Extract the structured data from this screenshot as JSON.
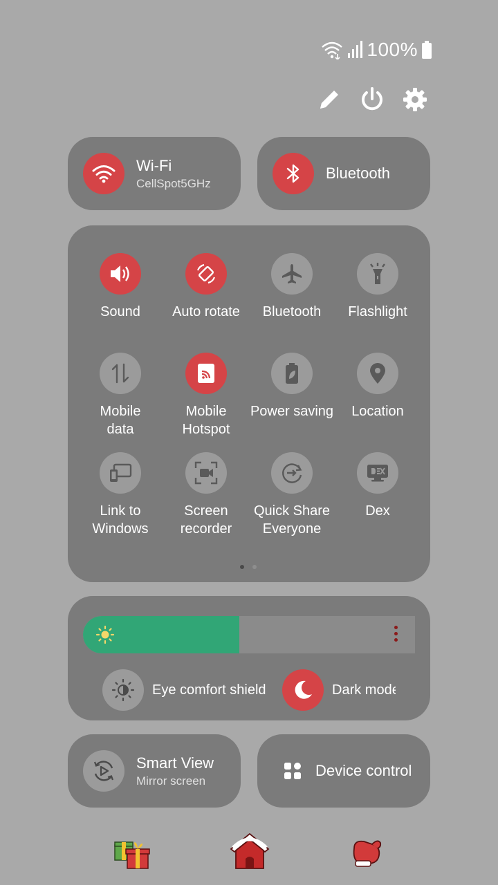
{
  "status_bar": {
    "battery_percent": "100%"
  },
  "top_actions": [
    {
      "name": "edit-icon"
    },
    {
      "name": "power-icon"
    },
    {
      "name": "settings-icon"
    }
  ],
  "wifi": {
    "label": "Wi-Fi",
    "network": "CellSpot5GHz",
    "state": "on"
  },
  "bluetooth_tile": {
    "label": "Bluetooth",
    "state": "on"
  },
  "quick_tiles": [
    {
      "label": "Sound",
      "icon": "sound-icon",
      "state": "on"
    },
    {
      "label": "Auto rotate",
      "icon": "auto-rotate-icon",
      "state": "on"
    },
    {
      "label": "Bluetooth",
      "icon": "airplane-icon",
      "state": "off"
    },
    {
      "label": "Flashlight",
      "icon": "flashlight-icon",
      "state": "off"
    },
    {
      "label": "Mobile\ndata",
      "icon": "mobile-data-icon",
      "state": "off"
    },
    {
      "label": "Mobile\nHotspot",
      "icon": "hotspot-icon",
      "state": "on"
    },
    {
      "label": "Power saving",
      "icon": "power-saving-icon",
      "state": "off"
    },
    {
      "label": "Location",
      "icon": "location-icon",
      "state": "off"
    },
    {
      "label": "Link to\nWindows",
      "icon": "link-to-windows-icon",
      "state": "off"
    },
    {
      "label": "Screen\nrecorder",
      "icon": "screen-recorder-icon",
      "state": "off"
    },
    {
      "label": "Quick Share\nEveryone",
      "icon": "quick-share-icon",
      "state": "off"
    },
    {
      "label": "Dex",
      "icon": "dex-icon",
      "state": "off"
    }
  ],
  "pagination": {
    "pages": 2,
    "current": 1
  },
  "brightness": {
    "level": 0.47
  },
  "eye_comfort": {
    "label": "Eye comfort shield",
    "state": "off"
  },
  "dark_mode": {
    "label": "Dark mode",
    "state": "on"
  },
  "smart_view": {
    "label": "Smart View",
    "sub": "Mirror screen"
  },
  "device_control": {
    "label": "Device control"
  },
  "dock": [
    "gifts-icon",
    "house-icon",
    "mitten-icon"
  ],
  "colors": {
    "background": "#a9a9a9",
    "panel": "#7b7b7b",
    "active": "#d54447",
    "inactive": "#9b9b9b",
    "slider_fill": "#31a676"
  }
}
